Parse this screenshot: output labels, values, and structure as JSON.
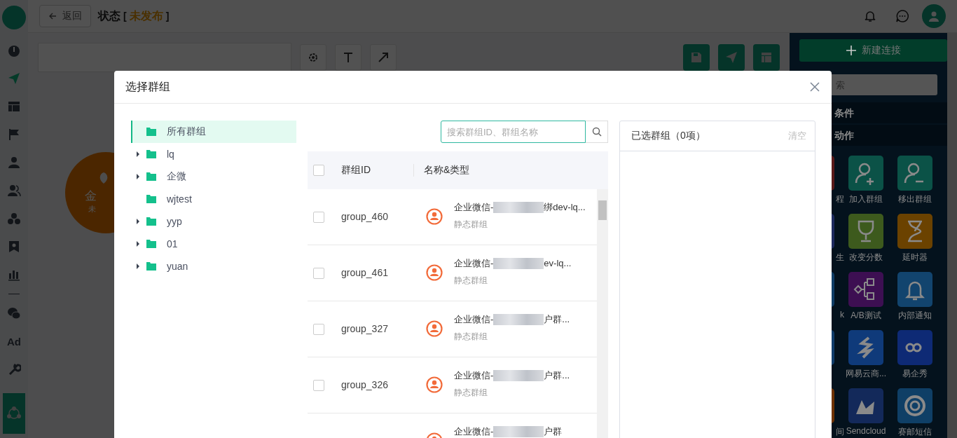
{
  "sidebar": {
    "primary": [
      {
        "selected": false
      },
      {
        "selected": true
      },
      {
        "selected": false
      },
      {
        "selected": false
      },
      {
        "selected": false
      },
      {
        "selected": false
      },
      {
        "selected": false
      },
      {
        "selected": false
      },
      {
        "selected": false
      }
    ],
    "secondary": [
      {
        "kind": "icon"
      },
      {
        "kind": "text",
        "label": "Ad"
      },
      {
        "kind": "icon"
      }
    ]
  },
  "header": {
    "back_label": "返回",
    "title": "状态",
    "bracket_open": "[",
    "status": "未发布",
    "bracket_close": "]"
  },
  "canvas": {
    "node": {
      "title": "金",
      "subtitle": "未"
    }
  },
  "palette": {
    "new_button": "新建连接",
    "search_placeholder": "索",
    "sections": [
      "条件",
      "动作"
    ],
    "tiles": [
      {
        "label": "程",
        "color": "#5a1a1a"
      },
      {
        "label": "加入群组",
        "color": "#0b5247"
      },
      {
        "label": "移出群组",
        "color": "#0b5247"
      },
      {
        "label": "生",
        "color": "#1e2a5e"
      },
      {
        "label": "改变分数",
        "color": "#3d5a1d"
      },
      {
        "label": "延时器",
        "color": "#6b4200"
      },
      {
        "label": "k",
        "color": "#0f3d66"
      },
      {
        "label": "A/B测试",
        "color": "#3d0f52"
      },
      {
        "label": "内部通知",
        "color": "#12446e"
      },
      {
        "color": "#103c6a"
      },
      {
        "label": "网易云商...",
        "color": "#0f3a7a"
      },
      {
        "label": "易企秀",
        "color": "#0e2a75"
      },
      {
        "label": "间",
        "color": "#6e3200"
      },
      {
        "label": "Sendcloud",
        "color": "#13295a"
      },
      {
        "label": "赛邮短信",
        "color": "#0f3f66"
      }
    ]
  },
  "dialog": {
    "title": "选择群组",
    "tree": [
      {
        "label": "所有群组",
        "expandable": false,
        "selected": true
      },
      {
        "label": "lq",
        "expandable": true,
        "selected": false
      },
      {
        "label": "企微",
        "expandable": true,
        "selected": false
      },
      {
        "label": "wjtest",
        "expandable": false,
        "selected": false
      },
      {
        "label": "yyp",
        "expandable": true,
        "selected": false
      },
      {
        "label": "01",
        "expandable": true,
        "selected": false
      },
      {
        "label": "yuan",
        "expandable": true,
        "selected": false
      }
    ],
    "search_placeholder": "搜索群组ID、群组名称",
    "table": {
      "header_checked": false,
      "columns": [
        "群组ID",
        "名称&类型"
      ],
      "rows": [
        {
          "checked": false,
          "id": "group_460",
          "name_start": "企业微信-",
          "name_end": "绑dev-lq...",
          "type": "静态群组"
        },
        {
          "checked": false,
          "id": "group_461",
          "name_start": "企业微信-",
          "name_end": "ev-lq...",
          "type": "静态群组"
        },
        {
          "checked": false,
          "id": "group_327",
          "name_start": "企业微信-",
          "name_end": "户群...",
          "type": "静态群组"
        },
        {
          "checked": false,
          "id": "group_326",
          "name_start": "企业微信-",
          "name_end": "户群...",
          "type": "静态群组"
        },
        {
          "name_start": "企业微信-",
          "name_end": "户群"
        }
      ]
    },
    "selected_panel": {
      "title": "已选群组（0项）",
      "clear": "清空"
    }
  }
}
